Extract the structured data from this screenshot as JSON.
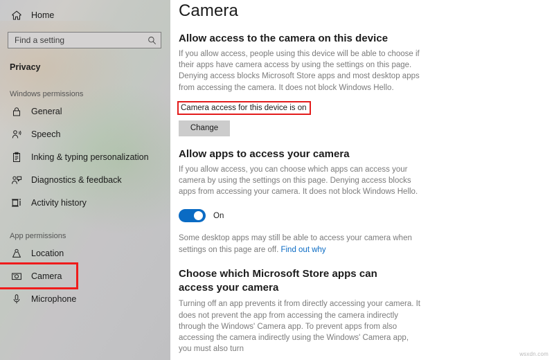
{
  "sidebar": {
    "home": {
      "label": "Home",
      "icon": "home-icon"
    },
    "search": {
      "placeholder": "Find a setting",
      "value": "",
      "icon": "search-icon"
    },
    "app_section": "Privacy",
    "groups": [
      {
        "label": "Windows permissions",
        "items": [
          {
            "label": "General",
            "icon": "lock-icon",
            "selected": false
          },
          {
            "label": "Speech",
            "icon": "speech-person-icon",
            "selected": false
          },
          {
            "label": "Inking & typing personalization",
            "icon": "clipboard-pen-icon",
            "selected": false
          },
          {
            "label": "Diagnostics & feedback",
            "icon": "person-feedback-icon",
            "selected": false
          },
          {
            "label": "Activity history",
            "icon": "activity-timeline-icon",
            "selected": false
          }
        ]
      },
      {
        "label": "App permissions",
        "items": [
          {
            "label": "Location",
            "icon": "location-pin-icon",
            "selected": false
          },
          {
            "label": "Camera",
            "icon": "camera-icon",
            "selected": true
          },
          {
            "label": "Microphone",
            "icon": "microphone-icon",
            "selected": false
          }
        ]
      }
    ]
  },
  "main": {
    "title": "Camera",
    "section_device": {
      "heading": "Allow access to the camera on this device",
      "body": "If you allow access, people using this device will be able to choose if their apps have camera access by using the settings on this page. Denying access blocks Microsoft Store apps and most desktop apps from accessing the camera. It does not block Windows Hello.",
      "status": "Camera access for this device is on",
      "change_button": "Change"
    },
    "section_apps": {
      "heading": "Allow apps to access your camera",
      "body": "If you allow access, you can choose which apps can access your camera by using the settings on this page. Denying access blocks apps from accessing your camera. It does not block Windows Hello.",
      "toggle_state": "On",
      "note_text": "Some desktop apps may still be able to access your camera when settings on this page are off. ",
      "note_link": "Find out why"
    },
    "section_store_apps": {
      "heading": "Choose which Microsoft Store apps can access your camera",
      "body": "Turning off an app prevents it from directly accessing your camera. It does not prevent the app from accessing the camera indirectly through the Windows' Camera app. To prevent apps from also accessing the camera indirectly using the Windows' Camera app, you must also turn"
    }
  },
  "watermark": "wsxdn.com",
  "colors": {
    "accent": "#0a6bc4",
    "annotation": "#e31b1b",
    "sidebar_bg": "#c6c5c6",
    "text": "#1b1b1b",
    "muted_text": "#7b7b7b"
  }
}
